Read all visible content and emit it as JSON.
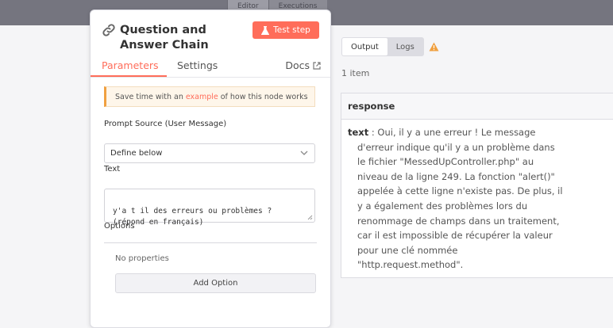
{
  "topbar": {
    "tabs": [
      "Editor",
      "Executions"
    ]
  },
  "node": {
    "title": "Question and Answer Chain",
    "test_step_label": "Test step",
    "tabs": [
      "Parameters",
      "Settings"
    ],
    "docs_label": "Docs",
    "notice": {
      "before": "Save time with an",
      "link": "example",
      "after": "of how this node works"
    },
    "prompt_source": {
      "label": "Prompt Source (User Message)",
      "value": "Define below"
    },
    "text_field": {
      "label": "Text",
      "value_lines": [
        "y'a t il des erreurs ou problèmes ?",
        "(répond en français)"
      ]
    },
    "options": {
      "label": "Options",
      "empty_text": "No properties",
      "add_label": "Add Option"
    }
  },
  "output": {
    "tabs": [
      "Output",
      "Logs"
    ],
    "item_count": "1 item",
    "column": "response",
    "key": "text",
    "value_lines": [
      ": Oui, il y a une erreur ! Le message",
      "d'erreur indique qu'il y a un problème dans",
      "le fichier \"MessedUpController.php\" au",
      "niveau de la ligne 249. La fonction \"alert()\"",
      "appelée à cette ligne n'existe pas. De plus, il",
      "y a également des problèmes lors du",
      "renommage de champs dans un traitement,",
      "car il est impossible de récupérer la valeur",
      "pour une clé nommée",
      "\"http.request.method\"."
    ]
  },
  "colors": {
    "accent": "#ff6d5a",
    "warning": "#f0a040"
  }
}
